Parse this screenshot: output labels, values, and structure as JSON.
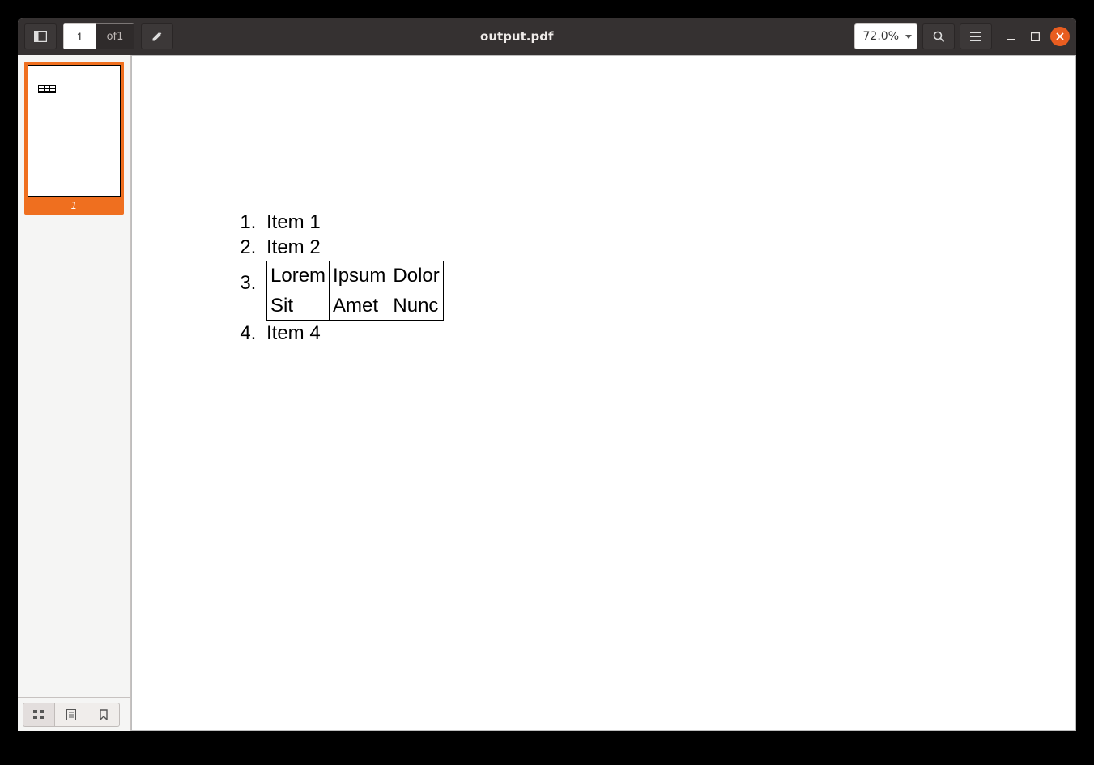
{
  "window": {
    "title": "output.pdf"
  },
  "toolbar": {
    "current_page": "1",
    "page_total_prefix": "of ",
    "page_total": "1",
    "zoom": "72.0%"
  },
  "sidebar": {
    "thumb": {
      "page_num": "1"
    }
  },
  "document": {
    "list": {
      "item_numbers": [
        "1.",
        "2.",
        "3.",
        "4."
      ],
      "items": {
        "0": "Item 1",
        "1": "Item 2",
        "3": "Item 4"
      },
      "item3_table": {
        "rows": [
          [
            "Lorem",
            "Ipsum",
            "Dolor"
          ],
          [
            "Sit",
            "Amet",
            "Nunc"
          ]
        ]
      }
    }
  }
}
